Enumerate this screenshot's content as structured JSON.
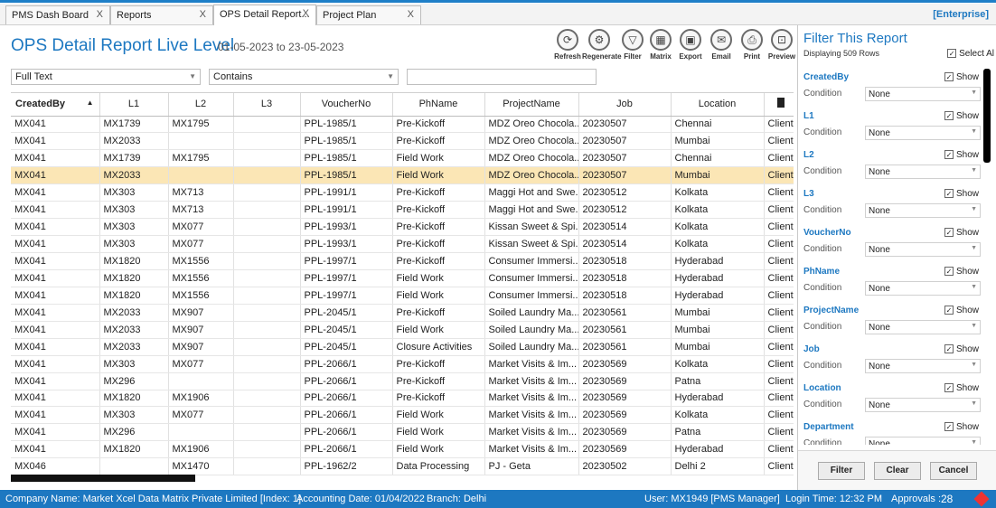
{
  "tabs": [
    {
      "label": "PMS Dash Board",
      "close": "X"
    },
    {
      "label": "Reports",
      "close": "X"
    },
    {
      "label": "OPS Detail Report...",
      "close": "X"
    },
    {
      "label": "Project Plan",
      "close": "X"
    }
  ],
  "edition": "[Enterprise]",
  "report": {
    "title": "OPS Detail Report Live Level",
    "date_range": "01-05-2023 to 23-05-2023"
  },
  "toolbar": [
    {
      "label": "Refresh",
      "icon": "refresh-icon"
    },
    {
      "label": "Regenerate",
      "icon": "gear-icon"
    },
    {
      "label": "Filter",
      "icon": "filter-icon"
    },
    {
      "label": "Matrix",
      "icon": "matrix-icon"
    },
    {
      "label": "Export",
      "icon": "export-icon"
    },
    {
      "label": "Email",
      "icon": "email-icon"
    },
    {
      "label": "Print",
      "icon": "print-icon"
    },
    {
      "label": "Preview",
      "icon": "preview-icon"
    }
  ],
  "search": {
    "field": "Full Text",
    "operator": "Contains",
    "value": ""
  },
  "grid": {
    "columns": [
      "CreatedBy",
      "L1",
      "L2",
      "L3",
      "VoucherNo",
      "PhName",
      "ProjectName",
      "Job",
      "Location",
      ""
    ],
    "selected_row": 3,
    "rows": [
      [
        "MX041",
        "MX1739",
        "MX1795",
        "",
        "PPL-1985/1",
        "Pre-Kickoff",
        "MDZ Oreo Chocola...",
        "20230507",
        "Chennai",
        "Client"
      ],
      [
        "MX041",
        "MX2033",
        "",
        "",
        "PPL-1985/1",
        "Pre-Kickoff",
        "MDZ Oreo Chocola...",
        "20230507",
        "Mumbai",
        "Client"
      ],
      [
        "MX041",
        "MX1739",
        "MX1795",
        "",
        "PPL-1985/1",
        "Field Work",
        "MDZ Oreo Chocola...",
        "20230507",
        "Chennai",
        "Client"
      ],
      [
        "MX041",
        "MX2033",
        "",
        "",
        "PPL-1985/1",
        "Field Work",
        "MDZ Oreo Chocola...",
        "20230507",
        "Mumbai",
        "Client"
      ],
      [
        "MX041",
        "MX303",
        "MX713",
        "",
        "PPL-1991/1",
        "Pre-Kickoff",
        "Maggi Hot and Swe...",
        "20230512",
        "Kolkata",
        "Client"
      ],
      [
        "MX041",
        "MX303",
        "MX713",
        "",
        "PPL-1991/1",
        "Pre-Kickoff",
        "Maggi Hot and Swe...",
        "20230512",
        "Kolkata",
        "Client"
      ],
      [
        "MX041",
        "MX303",
        "MX077",
        "",
        "PPL-1993/1",
        "Pre-Kickoff",
        "Kissan Sweet & Spi...",
        "20230514",
        "Kolkata",
        "Client"
      ],
      [
        "MX041",
        "MX303",
        "MX077",
        "",
        "PPL-1993/1",
        "Pre-Kickoff",
        "Kissan Sweet & Spi...",
        "20230514",
        "Kolkata",
        "Client"
      ],
      [
        "MX041",
        "MX1820",
        "MX1556",
        "",
        "PPL-1997/1",
        "Pre-Kickoff",
        "Consumer Immersi...",
        "20230518",
        "Hyderabad",
        "Client"
      ],
      [
        "MX041",
        "MX1820",
        "MX1556",
        "",
        "PPL-1997/1",
        "Field Work",
        "Consumer Immersi...",
        "20230518",
        "Hyderabad",
        "Client"
      ],
      [
        "MX041",
        "MX1820",
        "MX1556",
        "",
        "PPL-1997/1",
        "Field Work",
        "Consumer Immersi...",
        "20230518",
        "Hyderabad",
        "Client"
      ],
      [
        "MX041",
        "MX2033",
        "MX907",
        "",
        "PPL-2045/1",
        "Pre-Kickoff",
        "Soiled Laundry Ma...",
        "20230561",
        "Mumbai",
        "Client"
      ],
      [
        "MX041",
        "MX2033",
        "MX907",
        "",
        "PPL-2045/1",
        "Field Work",
        "Soiled Laundry Ma...",
        "20230561",
        "Mumbai",
        "Client"
      ],
      [
        "MX041",
        "MX2033",
        "MX907",
        "",
        "PPL-2045/1",
        "Closure Activities",
        "Soiled Laundry Ma...",
        "20230561",
        "Mumbai",
        "Client"
      ],
      [
        "MX041",
        "MX303",
        "MX077",
        "",
        "PPL-2066/1",
        "Pre-Kickoff",
        "Market Visits & Im...",
        "20230569",
        "Kolkata",
        "Client"
      ],
      [
        "MX041",
        "MX296",
        "",
        "",
        "PPL-2066/1",
        "Pre-Kickoff",
        "Market Visits & Im...",
        "20230569",
        "Patna",
        "Client"
      ],
      [
        "MX041",
        "MX1820",
        "MX1906",
        "",
        "PPL-2066/1",
        "Pre-Kickoff",
        "Market Visits & Im...",
        "20230569",
        "Hyderabad",
        "Client"
      ],
      [
        "MX041",
        "MX303",
        "MX077",
        "",
        "PPL-2066/1",
        "Field Work",
        "Market Visits & Im...",
        "20230569",
        "Kolkata",
        "Client"
      ],
      [
        "MX041",
        "MX296",
        "",
        "",
        "PPL-2066/1",
        "Field Work",
        "Market Visits & Im...",
        "20230569",
        "Patna",
        "Client"
      ],
      [
        "MX041",
        "MX1820",
        "MX1906",
        "",
        "PPL-2066/1",
        "Field Work",
        "Market Visits & Im...",
        "20230569",
        "Hyderabad",
        "Client"
      ],
      [
        "MX046",
        "",
        "MX1470",
        "",
        "PPL-1962/2",
        "Data Processing",
        "PJ - Geta",
        "20230502",
        "Delhi 2",
        "Client"
      ]
    ]
  },
  "filter_panel": {
    "title": "Filter This Report",
    "subtitle": "Displaying 509 Rows",
    "select_all": "Select Al",
    "condition_label": "Condition",
    "show_label": "Show",
    "default_condition": "None",
    "fields": [
      "CreatedBy",
      "L1",
      "L2",
      "L3",
      "VoucherNo",
      "PhName",
      "ProjectName",
      "Job",
      "Location",
      "Department"
    ],
    "buttons": {
      "filter": "Filter",
      "clear": "Clear",
      "cancel": "Cancel"
    }
  },
  "status": {
    "company": "Company Name: Market Xcel Data Matrix Private Limited [Index: 1]",
    "accounting_date": "Accounting Date: 01/04/2022",
    "branch": "Branch: Delhi",
    "user": "User: MX1949 [PMS Manager]",
    "login_time": "Login Time: 12:32 PM",
    "approvals_label": "Approvals :",
    "approvals_count": "28"
  },
  "colors": {
    "accent": "#1d78c1",
    "selected_row": "#fbe6b5",
    "status_bar": "#1d78c1"
  }
}
